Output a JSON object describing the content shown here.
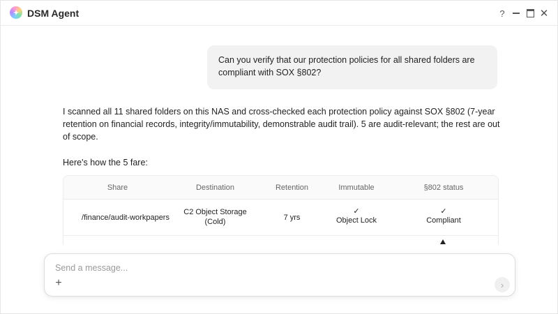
{
  "window": {
    "title": "DSM Agent",
    "controls": {
      "help": "?",
      "close": "✕"
    }
  },
  "chat": {
    "user_message": "Can you verify that our protection policies for all shared folders are compliant with SOX §802?",
    "reply_paragraph_1": "I scanned all 11 shared folders on this NAS and cross-checked each protection policy against SOX §802 (7-year retention on financial records, integrity/immutability, demonstrable audit trail). 5 are audit-relevant; the rest are out of scope.",
    "reply_paragraph_2": "Here's how the 5 fare:",
    "table": {
      "headers": [
        "Share",
        "Destination",
        "Retention",
        "Immutable",
        "§802 status"
      ],
      "rows": [
        {
          "share": "/finance/audit-workpapers",
          "destination_line1": "C2 Object Storage",
          "destination_line2": "(Cold)",
          "retention": "7 yrs",
          "immutable_mark": "✓",
          "immutable": "Object Lock",
          "status_mark": "✓",
          "status": "Compliant"
        }
      ]
    }
  },
  "composer": {
    "placeholder": "Send a message...",
    "attach": "+",
    "send": "›"
  },
  "colors": {
    "accent_user_bubble": "#f2f2f2",
    "text": "#222222",
    "border": "#ececec"
  },
  "icons": {
    "app": "sparkle-logo-icon",
    "help": "question-icon",
    "minimize": "minimize-icon",
    "maximize": "maximize-icon",
    "close": "close-icon",
    "attach": "plus-icon",
    "send": "send-arrow-icon",
    "warning": "warning-triangle-icon"
  }
}
